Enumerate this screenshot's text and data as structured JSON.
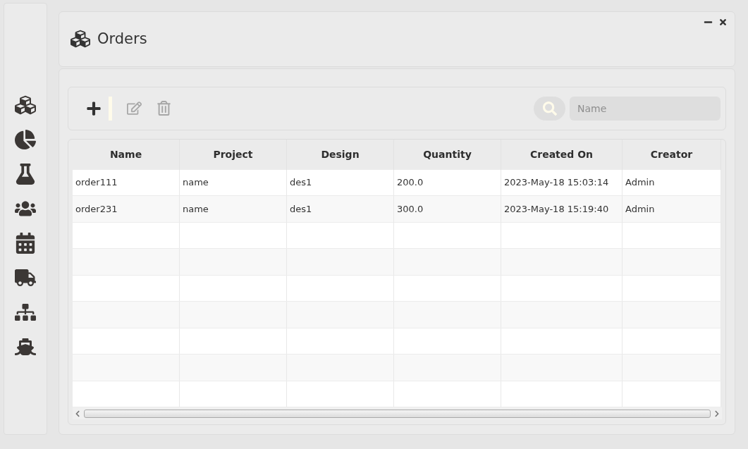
{
  "window": {
    "title": "Orders"
  },
  "toolbar": {
    "buttons": [
      {
        "kind": "add",
        "disabled": false
      },
      {
        "kind": "edit",
        "disabled": true
      },
      {
        "kind": "delete",
        "disabled": true
      }
    ],
    "search": {
      "placeholder": "Name"
    }
  },
  "table": {
    "columns": [
      "Name",
      "Project",
      "Design",
      "Quantity",
      "Created On",
      "Creator"
    ],
    "rows": [
      [
        "order111",
        "name",
        "des1",
        "200.0",
        "2023-May-18 15:03:14",
        "Admin"
      ],
      [
        "order231",
        "name",
        "des1",
        "300.0",
        "2023-May-18 15:19:40",
        "Admin"
      ]
    ]
  }
}
